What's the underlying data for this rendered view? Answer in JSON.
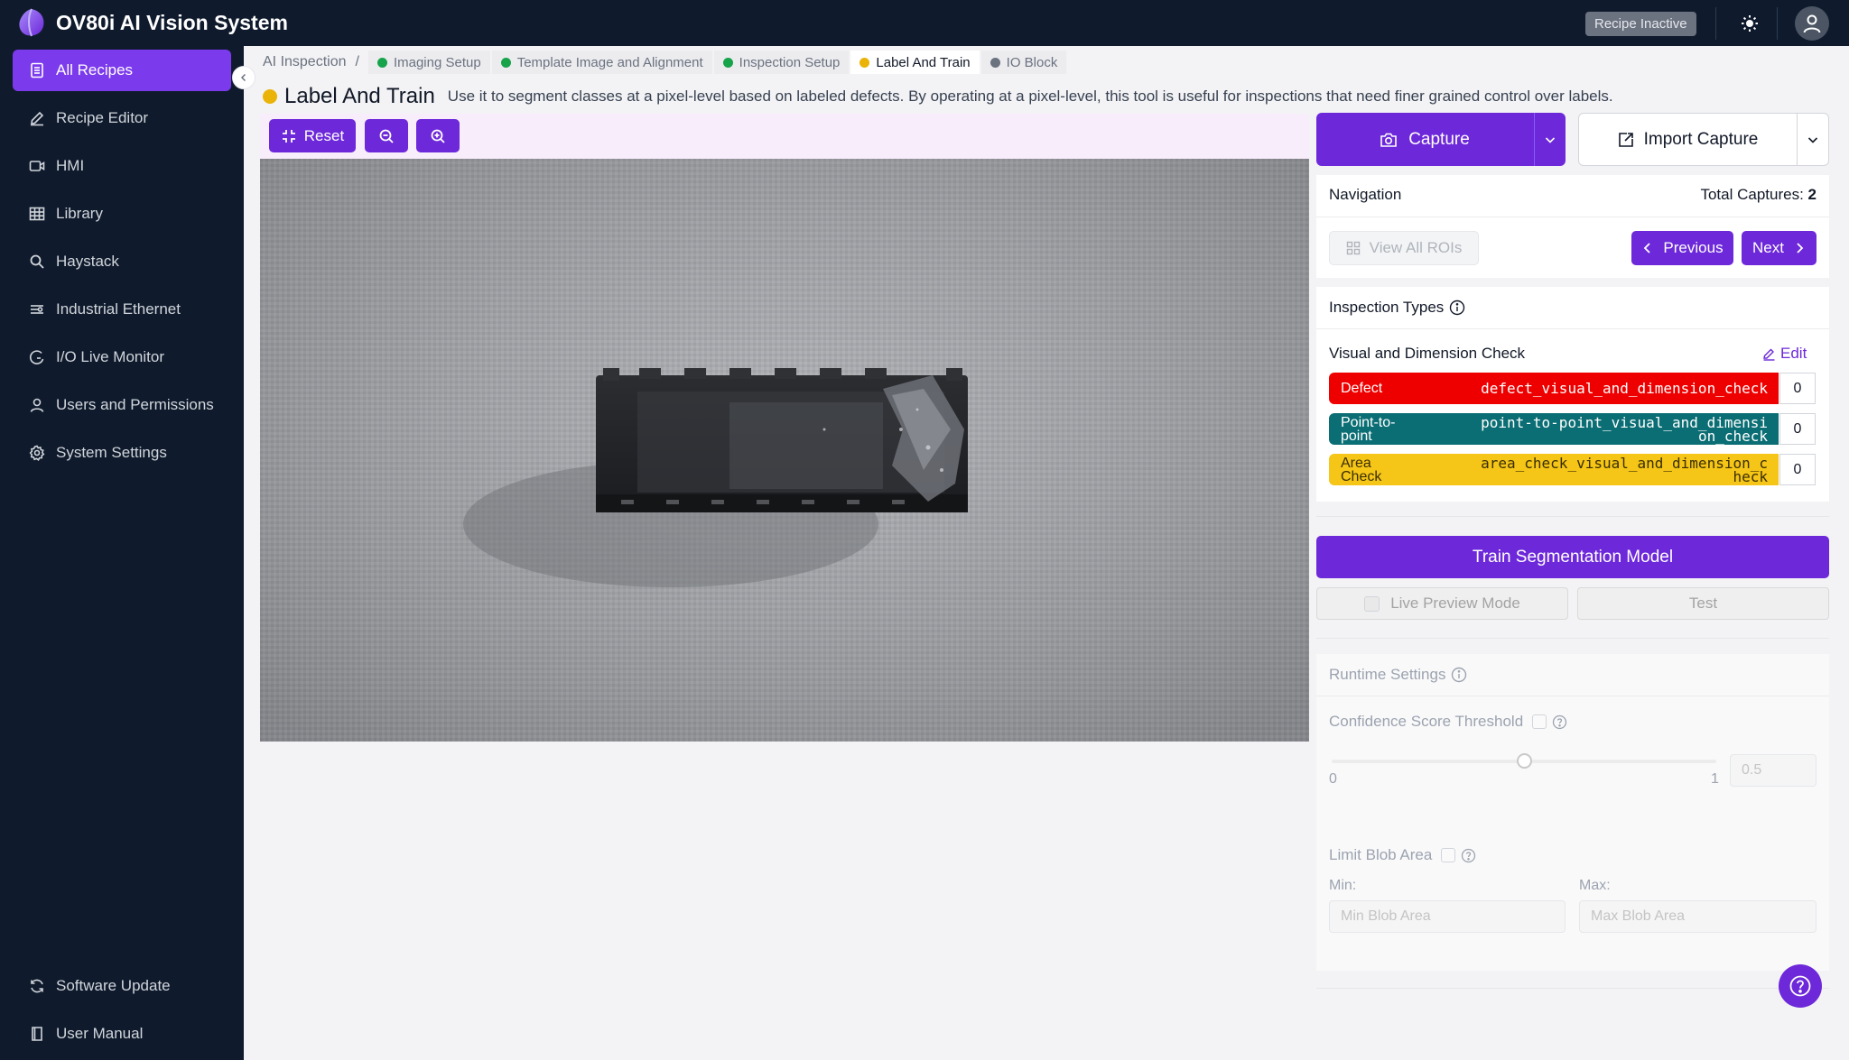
{
  "app": {
    "title": "OV80i AI Vision System",
    "recipe_status": "Recipe Inactive"
  },
  "sidebar": {
    "items": [
      {
        "label": "All Recipes",
        "icon": "document-list-icon"
      },
      {
        "label": "Recipe Editor",
        "icon": "pencil-icon"
      },
      {
        "label": "HMI",
        "icon": "video-icon"
      },
      {
        "label": "Library",
        "icon": "table-icon"
      },
      {
        "label": "Haystack",
        "icon": "search-icon"
      },
      {
        "label": "Industrial Ethernet",
        "icon": "network-icon"
      },
      {
        "label": "I/O Live Monitor",
        "icon": "gauge-icon"
      },
      {
        "label": "Users and Permissions",
        "icon": "user-icon"
      },
      {
        "label": "System Settings",
        "icon": "gear-icon"
      }
    ],
    "bottom": [
      {
        "label": "Software Update",
        "icon": "refresh-icon"
      },
      {
        "label": "User Manual",
        "icon": "book-icon"
      }
    ]
  },
  "breadcrumb": {
    "root": "AI Inspection",
    "separator": "/",
    "steps": [
      {
        "label": "Imaging Setup",
        "status_color": "#16a34a"
      },
      {
        "label": "Template Image and Alignment",
        "status_color": "#16a34a"
      },
      {
        "label": "Inspection Setup",
        "status_color": "#16a34a"
      },
      {
        "label": "Label And Train",
        "status_color": "#eab308"
      },
      {
        "label": "IO Block",
        "status_color": "#6b7280"
      }
    ]
  },
  "header": {
    "title": "Label And Train",
    "status_color": "#eab308",
    "description": "Use it to segment classes at a pixel-level based on labeled defects. By operating at a pixel-level, this tool is useful for inspections that need finer grained control over labels."
  },
  "viewer": {
    "reset_label": "Reset"
  },
  "capture": {
    "capture_label": "Capture",
    "import_label": "Import Capture"
  },
  "navigation": {
    "title": "Navigation",
    "total_captures_label": "Total Captures:",
    "total_captures_value": "2",
    "view_all_label": "View All ROIs",
    "previous_label": "Previous",
    "next_label": "Next"
  },
  "inspection_types": {
    "title": "Inspection Types",
    "group_name": "Visual and Dimension Check",
    "edit_label": "Edit",
    "types": [
      {
        "name": "Defect",
        "key": "defect_visual_and_dimension_check",
        "count": "0",
        "color": "#ee0000",
        "text_color": "#ffffff"
      },
      {
        "name": "Point-to-point",
        "key": "point-to-point_visual_and_dimension_check",
        "count": "0",
        "color": "#0b6e74",
        "text_color": "#ffffff"
      },
      {
        "name": "Area Check",
        "key": "area_check_visual_and_dimension_check",
        "count": "0",
        "color": "#f5c518",
        "text_color": "#3b2f00"
      }
    ]
  },
  "training": {
    "train_label": "Train Segmentation Model",
    "live_preview_label": "Live Preview Mode",
    "test_label": "Test"
  },
  "runtime": {
    "title": "Runtime Settings",
    "confidence_label": "Confidence Score Threshold",
    "slider_min": "0",
    "slider_max": "1",
    "slider_value": 0.5,
    "confidence_value": "0.5",
    "blob_label": "Limit Blob Area",
    "min_label": "Min:",
    "max_label": "Max:",
    "min_placeholder": "Min Blob Area",
    "max_placeholder": "Max Blob Area"
  }
}
